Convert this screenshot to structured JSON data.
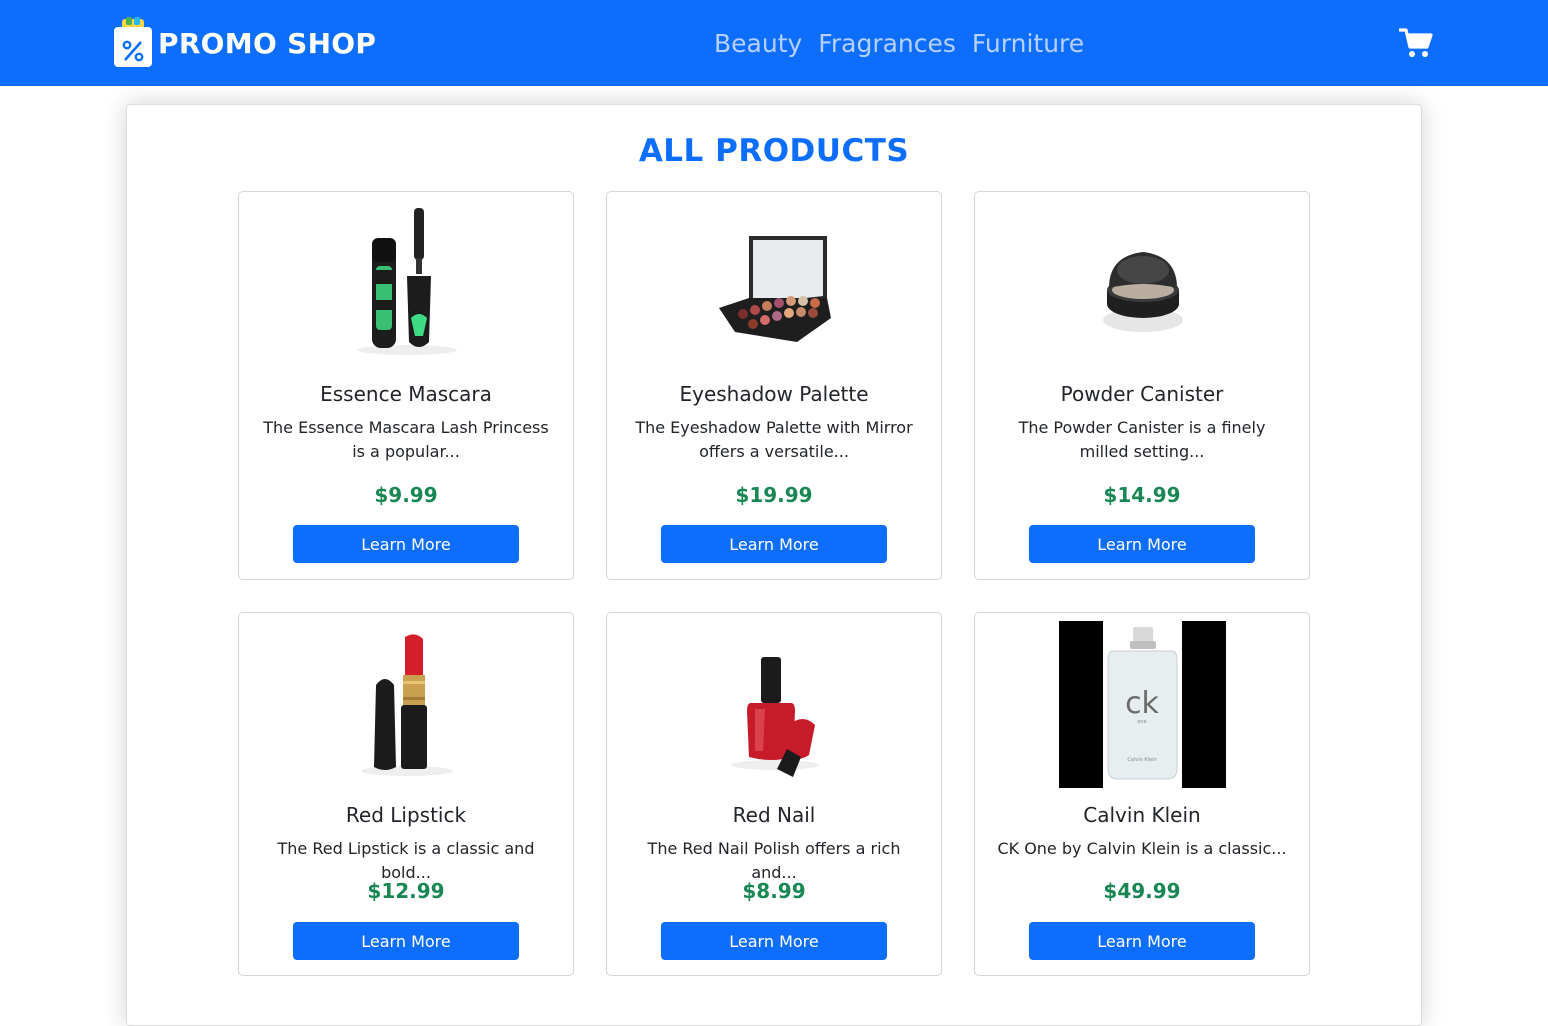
{
  "brand": {
    "name": "PROMO SHOP"
  },
  "nav": {
    "links": [
      "Beauty",
      "Fragrances",
      "Furniture"
    ]
  },
  "cart": {
    "icon": "cart-icon"
  },
  "main": {
    "title": "ALL PRODUCTS"
  },
  "colors": {
    "primary": "#0d6efd",
    "price": "#198754"
  },
  "products": [
    {
      "name": "Essence Mascara",
      "description": "The Essence Mascara Lash Princess is a popular...",
      "price": "$9.99",
      "button": "Learn More",
      "image": "mascara"
    },
    {
      "name": "Eyeshadow Palette",
      "description": "The Eyeshadow Palette with Mirror offers a versatile...",
      "price": "$19.99",
      "button": "Learn More",
      "image": "eyeshadow-palette"
    },
    {
      "name": "Powder Canister",
      "description": "The Powder Canister is a finely milled setting...",
      "price": "$14.99",
      "button": "Learn More",
      "image": "powder-canister"
    },
    {
      "name": "Red Lipstick",
      "description": "The Red Lipstick is a classic and bold...",
      "price": "$12.99",
      "button": "Learn More",
      "image": "lipstick"
    },
    {
      "name": "Red Nail",
      "description": "The Red Nail Polish offers a rich and...",
      "price": "$8.99",
      "button": "Learn More",
      "image": "nail-polish"
    },
    {
      "name": "Calvin Klein",
      "description": "CK One by Calvin Klein is a classic...",
      "price": "$49.99",
      "button": "Learn More",
      "image": "perfume-bottle"
    }
  ]
}
